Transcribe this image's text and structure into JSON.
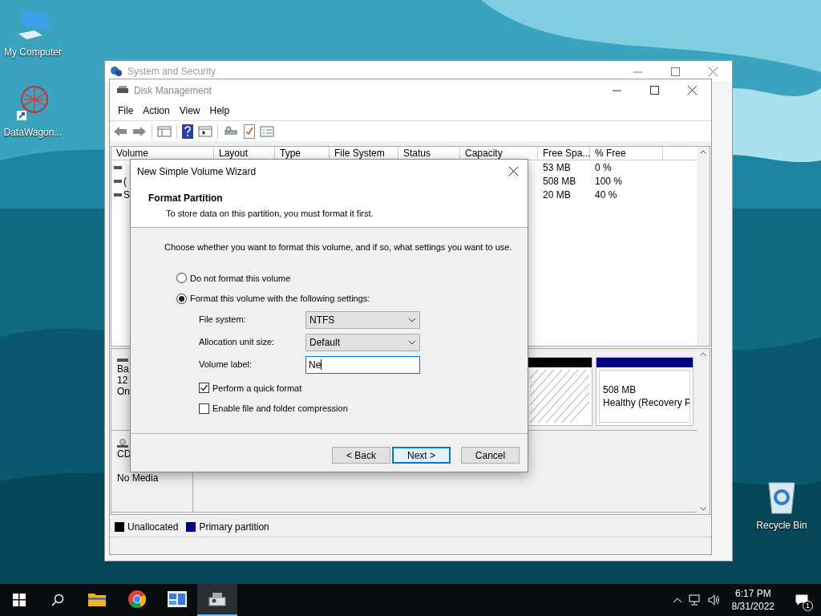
{
  "desktop_icons": [
    {
      "kind": "computer",
      "label": "My Computer"
    },
    {
      "kind": "shortcut",
      "label": "DataWagon..."
    },
    {
      "kind": "recycle",
      "label": "Recycle Bin"
    }
  ],
  "back_window": {
    "title": "System and Security"
  },
  "disk_management": {
    "title": "Disk Management",
    "menu": [
      "File",
      "Action",
      "View",
      "Help"
    ],
    "columns": [
      "Volume",
      "Layout",
      "Type",
      "File System",
      "Status",
      "Capacity",
      "Free Spa...",
      "% Free"
    ],
    "rows": [
      {
        "free_space": "53 MB",
        "percent_free": "0 %"
      },
      {
        "volume": "(",
        "free_space": "508 MB",
        "percent_free": "100 %"
      },
      {
        "volume": "S",
        "free_space": "20 MB",
        "percent_free": "40 %"
      }
    ],
    "disks": [
      {
        "kind": "disk",
        "lines": [
          "Ba",
          "12",
          "On"
        ],
        "partitions": [
          {
            "kind": "unallocated"
          },
          {
            "kind": "primary",
            "size": "508 MB",
            "status": "Healthy (Recovery P"
          }
        ]
      },
      {
        "kind": "cdrom",
        "lines": [
          "CD",
          "No Media"
        ]
      }
    ],
    "legend": [
      {
        "label": "Unallocated",
        "color": "#000000"
      },
      {
        "label": "Primary partition",
        "color": "#000080"
      }
    ]
  },
  "wizard": {
    "title": "New Simple Volume Wizard",
    "heading": "Format Partition",
    "subheading": "To store data on this partition, you must format it first.",
    "prompt": "Choose whether you want to format this volume, and if so, what settings you want to use.",
    "options": [
      {
        "label": "Do not format this volume",
        "selected": false
      },
      {
        "label": "Format this volume with the following settings:",
        "selected": true
      }
    ],
    "fields": [
      {
        "label": "File system:",
        "kind": "dropdown",
        "value": "NTFS"
      },
      {
        "label": "Allocation unit size:",
        "kind": "dropdown",
        "value": "Default"
      },
      {
        "label": "Volume label:",
        "kind": "text",
        "value": "Ne"
      }
    ],
    "checkboxes": [
      {
        "label": "Perform a quick format",
        "checked": true
      },
      {
        "label": "Enable file and folder compression",
        "checked": false
      }
    ],
    "buttons": [
      {
        "label": "< Back",
        "default": false
      },
      {
        "label": "Next >",
        "default": true
      },
      {
        "label": "Cancel",
        "default": false
      }
    ]
  },
  "taskbar": {
    "apps": [
      {
        "kind": "explorer",
        "active": false
      },
      {
        "kind": "chrome",
        "active": false
      },
      {
        "kind": "panel",
        "active": false
      },
      {
        "kind": "disk",
        "active": true
      }
    ],
    "time": "6:17 PM",
    "date": "8/31/2022",
    "notifications": "1"
  }
}
